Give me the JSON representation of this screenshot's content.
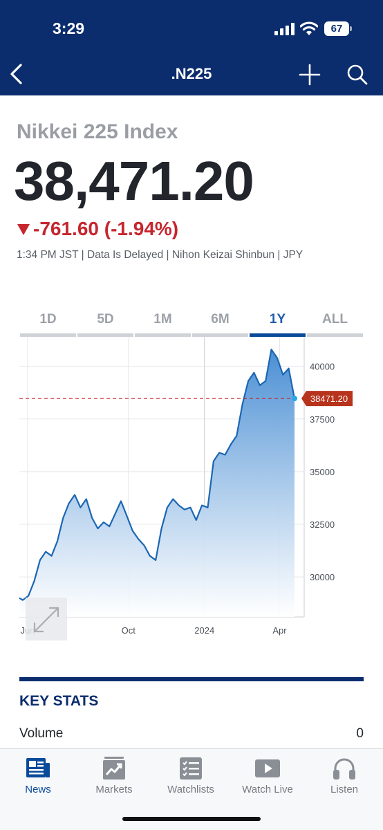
{
  "status_bar": {
    "time": "3:29",
    "battery": "67"
  },
  "nav": {
    "title": ".N225"
  },
  "quote": {
    "name": "Nikkei 225 Index",
    "price": "38,471.20",
    "change": "-761.60 (-1.94%)",
    "meta": "1:34 PM JST | Data Is Delayed | Nihon Keizai Shinbun | JPY"
  },
  "tabs": [
    {
      "label": "1D"
    },
    {
      "label": "5D"
    },
    {
      "label": "1M"
    },
    {
      "label": "6M"
    },
    {
      "label": "1Y"
    },
    {
      "label": "ALL"
    }
  ],
  "active_tab": "1Y",
  "chart_data": {
    "type": "area",
    "x_tick_labels": [
      "Jun",
      "Oct",
      "2024",
      "Apr"
    ],
    "y_ticks": [
      30000,
      32500,
      35000,
      37500,
      40000
    ],
    "ylim": [
      28100,
      41400
    ],
    "current_value": 38471.2,
    "current_label": "38471.20",
    "grid": true,
    "series": [
      {
        "points": [
          [
            "2023-05-22",
            29000
          ],
          [
            "2023-05-26",
            28900
          ],
          [
            "2023-06-02",
            29100
          ],
          [
            "2023-06-09",
            29800
          ],
          [
            "2023-06-16",
            30800
          ],
          [
            "2023-06-23",
            31200
          ],
          [
            "2023-06-30",
            31000
          ],
          [
            "2023-07-07",
            31700
          ],
          [
            "2023-07-14",
            32800
          ],
          [
            "2023-07-21",
            33500
          ],
          [
            "2023-07-28",
            33900
          ],
          [
            "2023-08-04",
            33300
          ],
          [
            "2023-08-11",
            33700
          ],
          [
            "2023-08-18",
            32800
          ],
          [
            "2023-08-25",
            32300
          ],
          [
            "2023-09-01",
            32600
          ],
          [
            "2023-09-08",
            32400
          ],
          [
            "2023-09-15",
            33000
          ],
          [
            "2023-09-22",
            33600
          ],
          [
            "2023-09-29",
            32900
          ],
          [
            "2023-10-06",
            32200
          ],
          [
            "2023-10-13",
            31800
          ],
          [
            "2023-10-20",
            31500
          ],
          [
            "2023-10-27",
            31000
          ],
          [
            "2023-11-03",
            30800
          ],
          [
            "2023-11-10",
            32300
          ],
          [
            "2023-11-17",
            33300
          ],
          [
            "2023-11-24",
            33700
          ],
          [
            "2023-12-01",
            33400
          ],
          [
            "2023-12-08",
            33200
          ],
          [
            "2023-12-15",
            33300
          ],
          [
            "2023-12-22",
            32700
          ],
          [
            "2023-12-29",
            33400
          ],
          [
            "2024-01-05",
            33300
          ],
          [
            "2024-01-12",
            35500
          ],
          [
            "2024-01-19",
            35900
          ],
          [
            "2024-01-26",
            35800
          ],
          [
            "2024-02-02",
            36300
          ],
          [
            "2024-02-09",
            36700
          ],
          [
            "2024-02-16",
            38200
          ],
          [
            "2024-02-23",
            39300
          ],
          [
            "2024-03-01",
            39700
          ],
          [
            "2024-03-08",
            39100
          ],
          [
            "2024-03-15",
            39300
          ],
          [
            "2024-03-22",
            40800
          ],
          [
            "2024-03-29",
            40400
          ],
          [
            "2024-04-05",
            39600
          ],
          [
            "2024-04-12",
            39900
          ],
          [
            "2024-04-19",
            38471.2
          ]
        ]
      }
    ]
  },
  "colors": {
    "header": "#0b2d6d",
    "line": "#1b66b3",
    "fill": "#4b8fd4",
    "down": "#c6262e",
    "badge": "#b8331c"
  },
  "key_stats": {
    "title": "KEY STATS",
    "volume_label": "Volume",
    "volume_value": "0"
  },
  "bottom_nav": [
    {
      "label": "News",
      "icon": "news-icon"
    },
    {
      "label": "Markets",
      "icon": "markets-icon"
    },
    {
      "label": "Watchlists",
      "icon": "watchlists-icon"
    },
    {
      "label": "Watch Live",
      "icon": "watch-live-icon"
    },
    {
      "label": "Listen",
      "icon": "listen-icon"
    }
  ],
  "active_nav": "News"
}
